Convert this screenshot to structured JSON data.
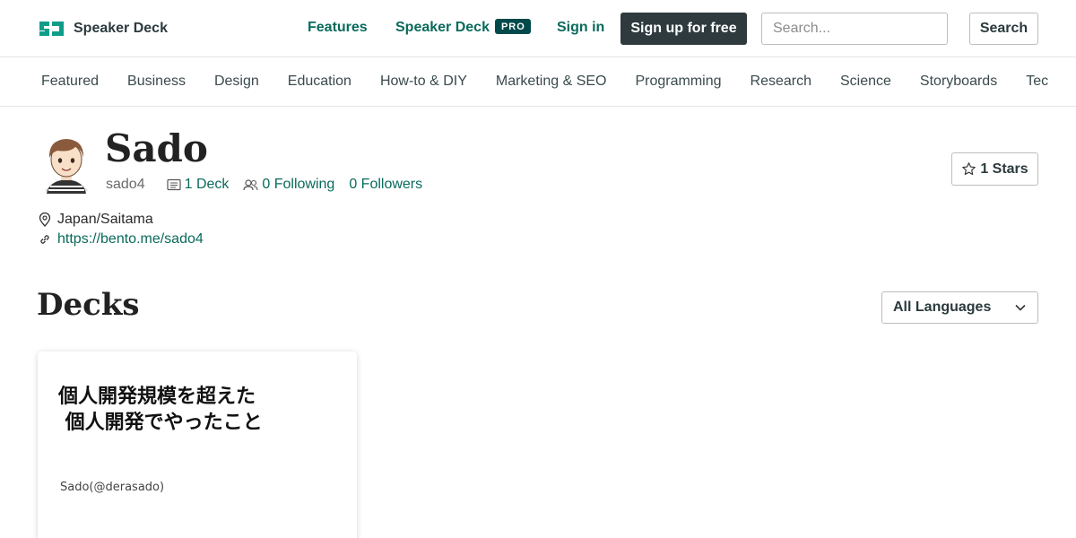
{
  "header": {
    "logo_text": "Speaker Deck",
    "nav_features": "Features",
    "nav_pro_label": "Speaker Deck",
    "nav_pro_badge": "PRO",
    "nav_signin": "Sign in",
    "signup_label": "Sign up for free",
    "search_placeholder": "Search...",
    "search_button": "Search"
  },
  "categories": [
    "Featured",
    "Business",
    "Design",
    "Education",
    "How-to & DIY",
    "Marketing & SEO",
    "Programming",
    "Research",
    "Science",
    "Storyboards",
    "Technology"
  ],
  "profile": {
    "name": "Sado",
    "handle": "sado4",
    "decks": "1 Deck",
    "following": "0 Following",
    "followers": "0 Followers",
    "stars": "1 Stars",
    "location": "Japan/Saitama",
    "url": "https://bento.me/sado4"
  },
  "decks_section": {
    "title": "Decks",
    "language_select": "All Languages"
  },
  "deck": {
    "slide_title": "個人開発規模を超えた\n 個人開発でやったこと",
    "slide_author": "Sado(@derasado)"
  },
  "colors": {
    "brand": "#0a6a5c",
    "pro_badge": "#00494a",
    "signup_bg": "#2e3a3e"
  }
}
